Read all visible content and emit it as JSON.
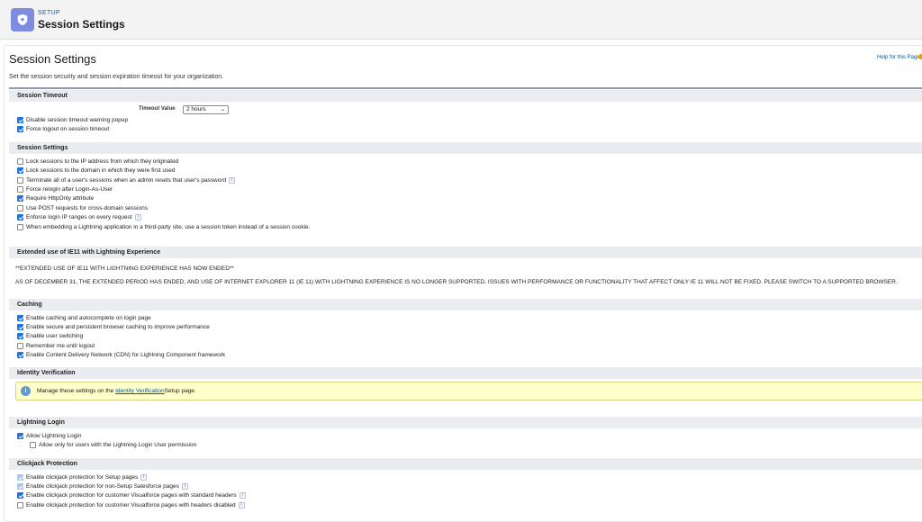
{
  "header": {
    "crumb": "SETUP",
    "title": "Session Settings",
    "icon": "shield-icon",
    "accent": "#7f8de1"
  },
  "page": {
    "title": "Session Settings",
    "help_link": "Help for this Page",
    "description": "Set the session security and session expiration timeout for your organization."
  },
  "session_timeout": {
    "heading": "Session Timeout",
    "timeout_label": "Timeout Value",
    "timeout_value": "2 hours",
    "items": [
      {
        "label": "Disable session timeout warning popup",
        "checked": true
      },
      {
        "label": "Force logout on session timeout",
        "checked": true
      }
    ]
  },
  "session_settings": {
    "heading": "Session Settings",
    "items": [
      {
        "label": "Lock sessions to the IP address from which they originated",
        "checked": false,
        "info": false
      },
      {
        "label": "Lock sessions to the domain in which they were first used",
        "checked": true,
        "info": false
      },
      {
        "label": "Terminate all of a user's sessions when an admin resets that user's password",
        "checked": false,
        "info": true
      },
      {
        "label": "Force relogin after Login-As-User",
        "checked": false,
        "info": false
      },
      {
        "label": "Require HttpOnly attribute",
        "checked": true,
        "info": false
      },
      {
        "label": "Use POST requests for cross-domain sessions",
        "checked": false,
        "info": false
      },
      {
        "label": "Enforce login IP ranges on every request",
        "checked": true,
        "info": true
      },
      {
        "label": "When embedding a Lightning application in a third-party site, use a session token instead of a session cookie.",
        "checked": false,
        "info": false
      }
    ]
  },
  "ie11": {
    "heading": "Extended use of IE11 with Lightning Experience",
    "line1": "**EXTENDED USE OF IE11 WITH LIGHTNING EXPERIENCE HAS NOW ENDED**",
    "line2": "AS OF DECEMBER 31, THE EXTENDED PERIOD HAS ENDED, AND USE OF INTERNET EXPLORER 11 (IE 11) WITH LIGHTNING EXPERIENCE IS NO LONGER SUPPORTED. ISSUES WITH PERFORMANCE OR FUNCTIONALITY THAT AFFECT ONLY IE 11 WILL NOT BE FIXED. PLEASE SWITCH TO A SUPPORTED BROWSER."
  },
  "caching": {
    "heading": "Caching",
    "items": [
      {
        "label": "Enable caching and autocomplete on login page",
        "checked": true
      },
      {
        "label": "Enable secure and persistent browser caching to improve performance",
        "checked": true
      },
      {
        "label": "Enable user switching",
        "checked": true
      },
      {
        "label": "Remember me until logout",
        "checked": false
      },
      {
        "label": "Enable Content Delivery Network (CDN) for Lightning Component framework",
        "checked": true
      }
    ]
  },
  "identity": {
    "heading": "Identity Verification",
    "notice_before": "Manage these settings on the ",
    "notice_link": "Identity Verification",
    "notice_after": " Setup page."
  },
  "lightning_login": {
    "heading": "Lightning Login",
    "items": [
      {
        "label": "Allow Lightning Login",
        "checked": true
      },
      {
        "label": "Allow only for users with the Lightning Login User permission",
        "checked": false
      }
    ]
  },
  "clickjack": {
    "heading": "Clickjack Protection",
    "items": [
      {
        "label": "Enable clickjack protection for Setup pages",
        "checked": true,
        "disabled": true
      },
      {
        "label": "Enable clickjack protection for non-Setup Salesforce pages",
        "checked": true,
        "disabled": true
      },
      {
        "label": "Enable clickjack protection for customer Visualforce pages with standard headers",
        "checked": true,
        "disabled": false
      },
      {
        "label": "Enable clickjack protection for customer Visualforce pages with headers disabled",
        "checked": false,
        "disabled": false
      }
    ]
  }
}
